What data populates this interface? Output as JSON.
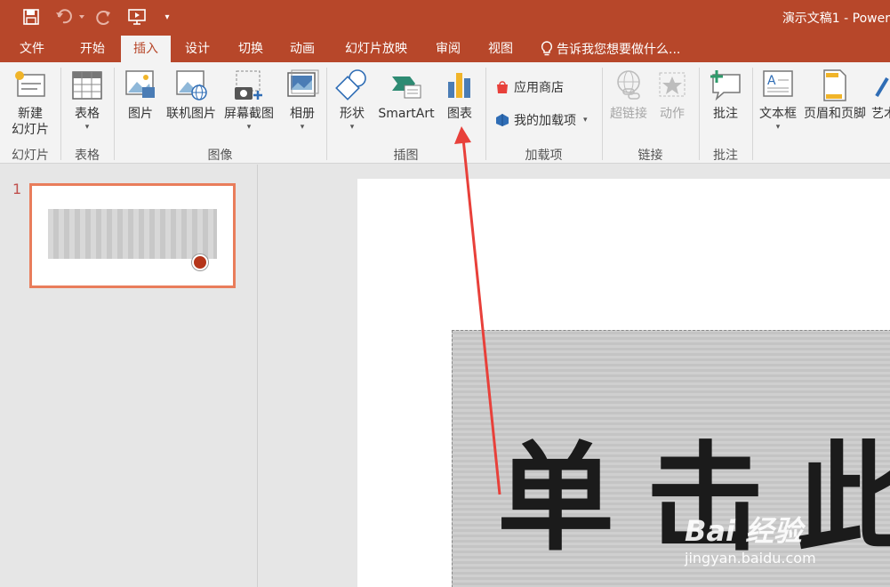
{
  "window": {
    "title": "演示文稿1 - Power"
  },
  "tabs": [
    "文件",
    "开始",
    "插入",
    "设计",
    "切换",
    "动画",
    "幻灯片放映",
    "审阅",
    "视图"
  ],
  "active_tab": "插入",
  "tellme": "告诉我您想要做什么...",
  "ribbon": {
    "new_slide_line1": "新建",
    "new_slide_line2": "幻灯片",
    "table": "表格",
    "picture": "图片",
    "online_picture": "联机图片",
    "screenshot": "屏幕截图",
    "album": "相册",
    "shapes": "形状",
    "smartart": "SmartArt",
    "chart": "图表",
    "store": "应用商店",
    "my_addins": "我的加载项",
    "hyperlink": "超链接",
    "action": "动作",
    "comment": "批注",
    "textbox": "文本框",
    "header_footer": "页眉和页脚",
    "wordart": "艺术",
    "groups": {
      "slides": "幻灯片",
      "tables": "表格",
      "images": "图像",
      "illustrations": "插图",
      "addins": "加载项",
      "links": "链接",
      "comments": "批注"
    }
  },
  "thumbnail": {
    "number": "1"
  },
  "slide": {
    "placeholder_text": "单击此处"
  },
  "watermark": {
    "main": "Bai 经验",
    "sub": "jingyan.baidu.com"
  },
  "colors": {
    "accent": "#b7472a",
    "arrow": "#e8403a"
  }
}
